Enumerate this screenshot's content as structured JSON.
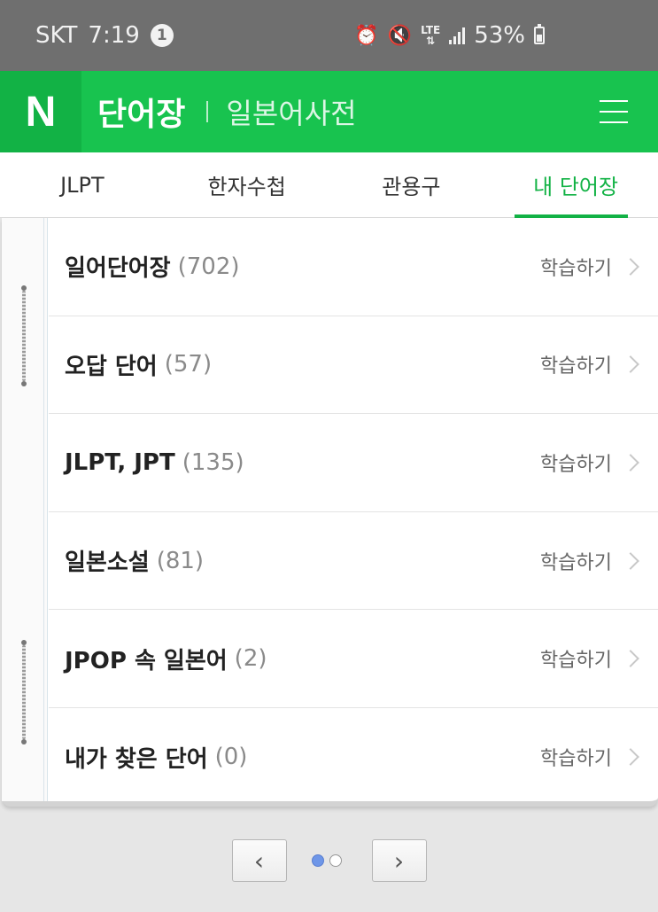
{
  "status_bar": {
    "carrier": "SKT",
    "time": "7:19",
    "notification_count": "1",
    "network": "LTE",
    "battery": "53%"
  },
  "header": {
    "logo": "N",
    "title": "단어장",
    "subtitle": "일본어사전"
  },
  "tabs": [
    {
      "label": "JLPT",
      "active": false
    },
    {
      "label": "한자수첩",
      "active": false
    },
    {
      "label": "관용구",
      "active": false
    },
    {
      "label": "내 단어장",
      "active": true
    }
  ],
  "wordbooks": [
    {
      "name": "일어단어장",
      "count": "(702)",
      "action": "학습하기"
    },
    {
      "name": "오답 단어",
      "count": "(57)",
      "action": "학습하기"
    },
    {
      "name": "JLPT, JPT",
      "count": "(135)",
      "action": "학습하기"
    },
    {
      "name": "일본소설",
      "count": "(81)",
      "action": "학습하기"
    },
    {
      "name": "JPOP 속 일본어",
      "count": "(2)",
      "action": "학습하기"
    },
    {
      "name": "내가 찾은 단어",
      "count": "(0)",
      "action": "학습하기"
    }
  ],
  "pager": {
    "prev": "‹",
    "next": "›",
    "total_pages": 2,
    "current_page": 1
  },
  "colors": {
    "brand_green": "#18c34f",
    "logo_green": "#12b245",
    "active_dot": "#6e96e8"
  }
}
